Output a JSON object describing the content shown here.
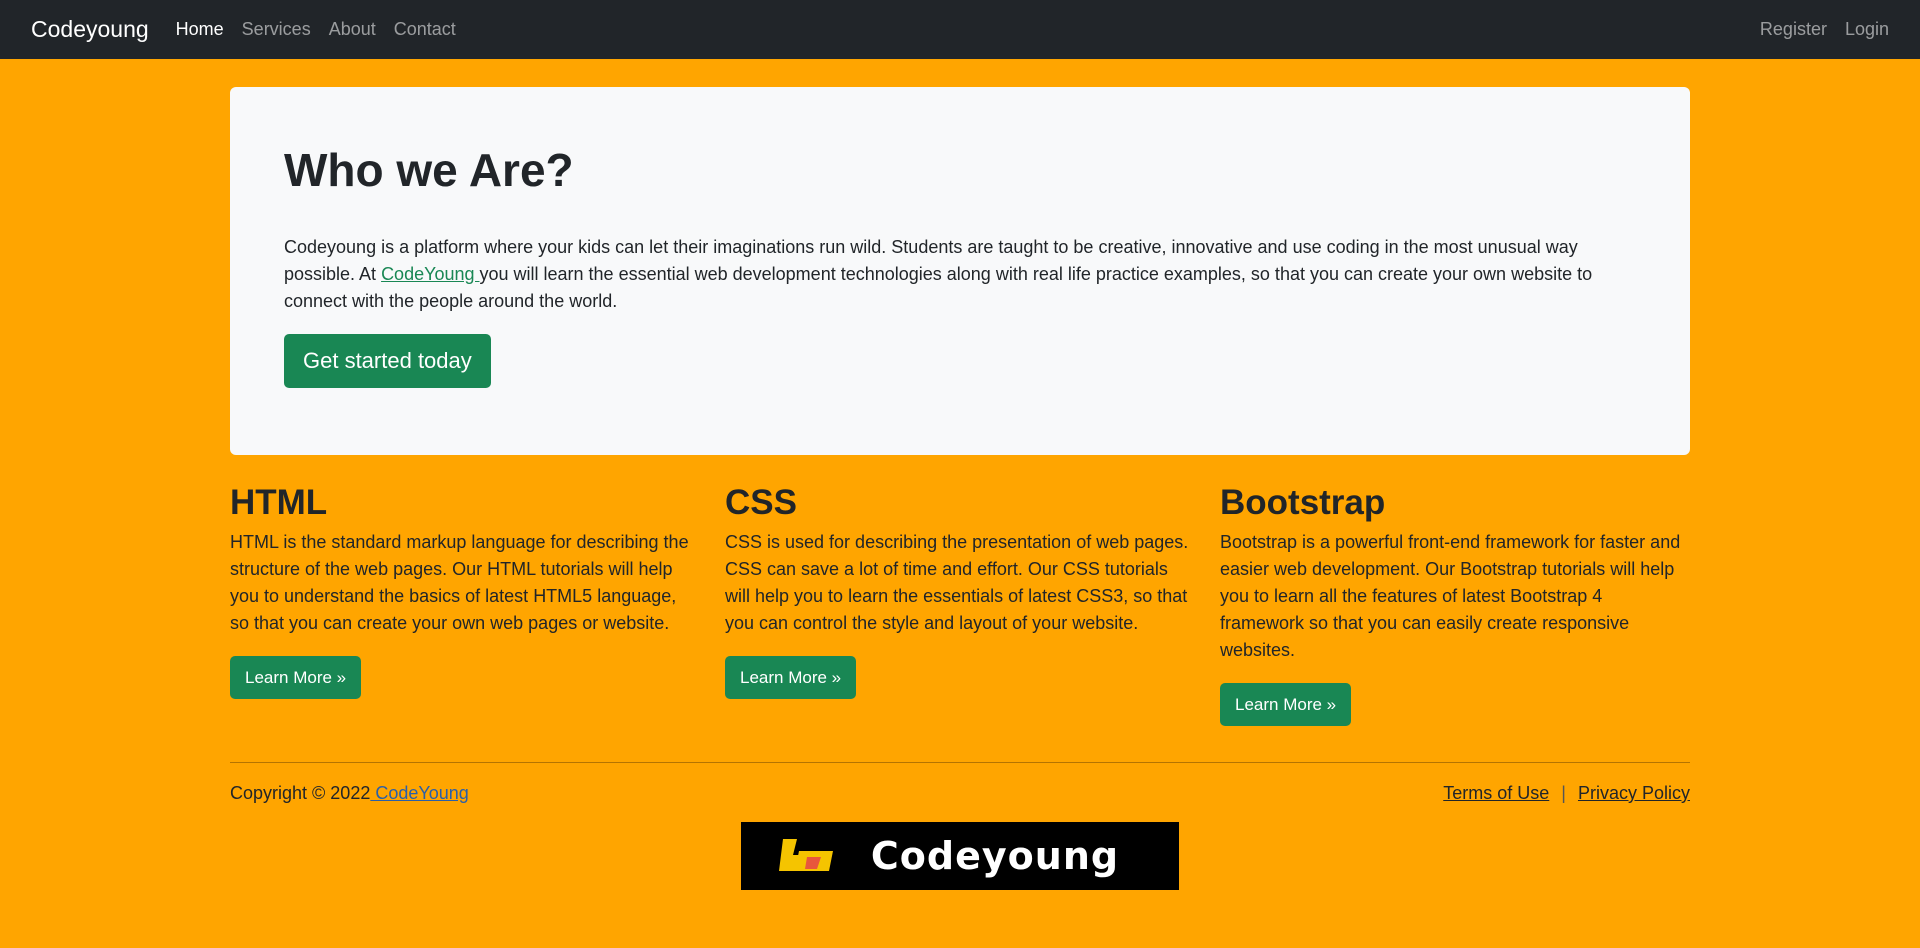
{
  "nav": {
    "brand": "Codeyoung",
    "links": [
      "Home",
      "Services",
      "About",
      "Contact"
    ],
    "right": [
      "Register",
      "Login"
    ]
  },
  "hero": {
    "title": "Who we Are?",
    "text_before": "Codeyoung is a platform where your kids can let their imaginations run wild. Students are taught to be creative, innovative and use coding in the most unusual way possible. At ",
    "link": "CodeYoung ",
    "text_after": "you will learn the essential web development technologies along with real life practice examples, so that you can create your own website to connect with the people around the world.",
    "button": "Get started today"
  },
  "columns": [
    {
      "title": "HTML",
      "text": "HTML is the standard markup language for describing the structure of the web pages. Our HTML tutorials will help you to understand the basics of latest HTML5 language, so that you can create your own web pages or website.",
      "button": "Learn More »"
    },
    {
      "title": "CSS",
      "text": "CSS is used for describing the presentation of web pages. CSS can save a lot of time and effort. Our CSS tutorials will help you to learn the essentials of latest CSS3, so that you can control the style and layout of your website.",
      "button": "Learn More »"
    },
    {
      "title": "Bootstrap",
      "text": "Bootstrap is a powerful front-end framework for faster and easier web development. Our Bootstrap tutorials will help you to learn all the features of latest Bootstrap 4 framework so that you can easily create responsive websites.",
      "button": "Learn More »"
    }
  ],
  "footer": {
    "copyright": "Copyright © 2022",
    "brand_link": " CodeYoung",
    "terms": "Terms of Use",
    "separator": "|",
    "privacy": "Privacy Policy"
  },
  "logo": {
    "text": "Codeyoung",
    "icon": "codeyoung-logo-icon"
  },
  "colors": {
    "page_bg": "#ffa500",
    "navbar": "#212529",
    "accent": "#198754",
    "card": "#f8f9fa"
  }
}
